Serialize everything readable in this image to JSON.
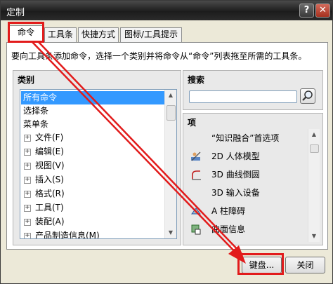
{
  "window": {
    "title": "定制",
    "help_btn": "?",
    "close_btn": "✕"
  },
  "tabs": [
    {
      "label": "命令"
    },
    {
      "label": "工具条"
    },
    {
      "label": "快捷方式"
    },
    {
      "label": "图标/工具提示"
    }
  ],
  "instruction": "要向工具条添加命令，选择一个类别并将命令从“命令”列表拖至所需的工具条。",
  "categories": {
    "header": "类别",
    "items": [
      {
        "label": "所有命令",
        "selected": true
      },
      {
        "label": "选择条"
      },
      {
        "label": "菜单条"
      },
      {
        "label": "文件(F)",
        "expandable": true
      },
      {
        "label": "编辑(E)",
        "expandable": true
      },
      {
        "label": "视图(V)",
        "expandable": true
      },
      {
        "label": "插入(S)",
        "expandable": true
      },
      {
        "label": "格式(R)",
        "expandable": true
      },
      {
        "label": "工具(T)",
        "expandable": true
      },
      {
        "label": "装配(A)",
        "expandable": true
      },
      {
        "label": "产品制造信息(M)",
        "expandable": true
      }
    ]
  },
  "search": {
    "header": "搜索",
    "value": "",
    "placeholder": ""
  },
  "items_panel": {
    "header": "项",
    "items": [
      {
        "label": "“知识融合”首选项",
        "icon": "none"
      },
      {
        "label": "2D 人体模型",
        "icon": "human-model-icon"
      },
      {
        "label": "3D 曲线倒圆",
        "icon": "curve-fillet-icon"
      },
      {
        "label": "3D 输入设备",
        "icon": "none"
      },
      {
        "label": "A 柱障碍",
        "icon": "a-pillar-icon"
      },
      {
        "label": "曲面信息",
        "icon": "surface-info-icon"
      }
    ]
  },
  "buttons": {
    "keyboard": "键盘...",
    "close": "关闭"
  },
  "colors": {
    "highlight": "#e21b1b",
    "selection": "#3399ff"
  }
}
